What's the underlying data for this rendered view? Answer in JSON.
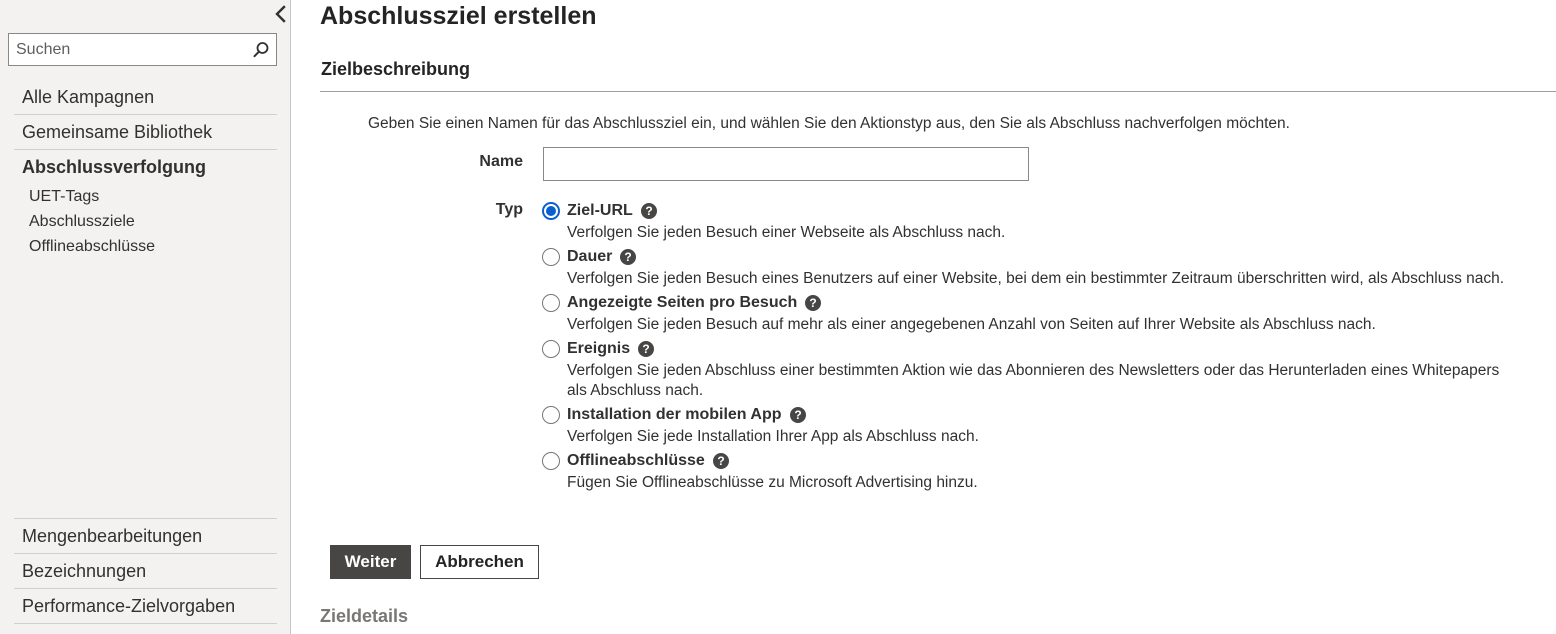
{
  "sidebar": {
    "search_placeholder": "Suchen",
    "nav_items": [
      {
        "label": "Alle Kampagnen"
      },
      {
        "label": "Gemeinsame Bibliothek"
      },
      {
        "label": "Abschlussverfolgung",
        "active": true
      }
    ],
    "sub_items": [
      {
        "label": "UET-Tags"
      },
      {
        "label": "Abschlussziele"
      },
      {
        "label": "Offlineabschlüsse"
      }
    ],
    "bottom_items": [
      {
        "label": "Mengenbearbeitungen"
      },
      {
        "label": "Bezeichnungen"
      },
      {
        "label": "Performance-Zielvorgaben"
      }
    ]
  },
  "main": {
    "title": "Abschlussziel erstellen",
    "section_title": "Zielbeschreibung",
    "instruction": "Geben Sie einen Namen für das Abschlussziel ein, und wählen Sie den Aktionstyp aus, den Sie als Abschluss nachverfolgen möchten.",
    "name_label": "Name",
    "name_value": "",
    "type_label": "Typ",
    "selected_type": "Ziel-URL",
    "types": [
      {
        "label": "Ziel-URL",
        "description": "Verfolgen Sie jeden Besuch einer Webseite als Abschluss nach."
      },
      {
        "label": "Dauer",
        "description": "Verfolgen Sie jeden Besuch eines Benutzers auf einer Website, bei dem ein bestimmter Zeitraum überschritten wird, als Abschluss nach."
      },
      {
        "label": "Angezeigte Seiten pro Besuch",
        "description": "Verfolgen Sie jeden Besuch auf mehr als einer angegebenen Anzahl von Seiten auf Ihrer Website als Abschluss nach."
      },
      {
        "label": "Ereignis",
        "description": "Verfolgen Sie jeden Abschluss einer bestimmten Aktion wie das Abonnieren des Newsletters oder das Herunterladen eines Whitepapers als Abschluss nach."
      },
      {
        "label": "Installation der mobilen App",
        "description": "Verfolgen Sie jede Installation Ihrer App als Abschluss nach."
      },
      {
        "label": "Offlineabschlüsse",
        "description": "Fügen Sie Offlineabschlüsse zu Microsoft Advertising hinzu."
      }
    ],
    "next_button": "Weiter",
    "cancel_button": "Abbrechen",
    "section2_title": "Zieldetails"
  },
  "icons": {
    "collapse": "chevron-left-icon",
    "search": "search-icon",
    "help": "question-circle-icon"
  },
  "colors": {
    "sidebar_bg": "#f3f2f1",
    "radio_selected": "#0a5fd0",
    "primary_button": "#484644"
  }
}
